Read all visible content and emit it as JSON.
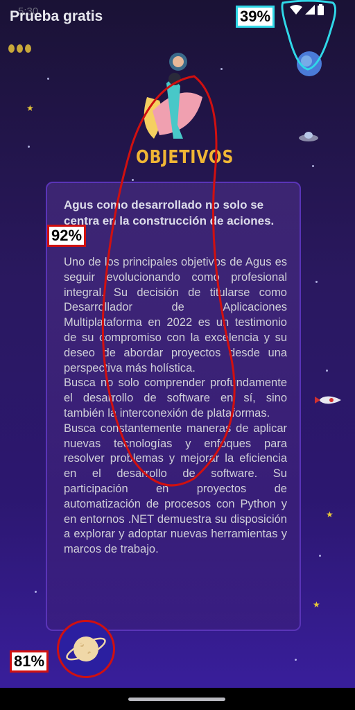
{
  "status_bar": {
    "clock": "5:30",
    "battery_icon": "battery-icon",
    "wifi_icon": "wifi-icon",
    "signal_icon": "signal-icon"
  },
  "app": {
    "title": "Prueba gratis"
  },
  "hero": {
    "label": "OBJETIVOS"
  },
  "card": {
    "heading": "Agus como desarrollado no solo se centra en la construcción de aciones.",
    "paragraphs": [
      "Uno de los principales objetivos de Agus es seguir evolucionando como profesional integral. Su decisión de titularse como Desarrollador de Aplicaciones Multiplataforma en 2022 es un testimonio de su compromiso con la excelencia y su deseo de abordar proyectos desde una perspectiva más holística.",
      "Busca no solo comprender profundamente el desarrollo de software en sí, sino también la interconexión de plataformas.",
      "Busca constantemente maneras de aplicar nuevas tecnologías y enfoques para resolver problemas y mejorar la eficiencia en el desarrollo de software. Su participación en proyectos de automatización de procesos con Python y en entornos .NET demuestra su disposición a explorar y adoptar nuevas herramientas y marcos de trabajo."
    ]
  },
  "annotations": {
    "badge_status": "39%",
    "badge_card": "92%",
    "badge_planet": "81%"
  },
  "colors": {
    "highlight_red": "#d01010",
    "highlight_cyan": "#30d8e8",
    "accent_gold": "#f0b635",
    "card_border": "#5a34b8"
  }
}
